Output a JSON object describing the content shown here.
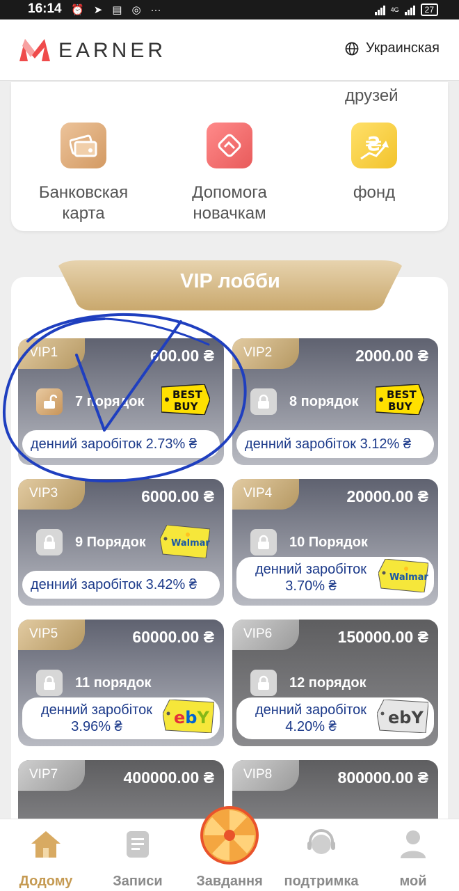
{
  "status_bar": {
    "time": "16:14",
    "icons": [
      "alarm-icon",
      "telegram-icon",
      "message-icon",
      "instagram-icon"
    ],
    "more": "···",
    "network": "4G",
    "battery": "27"
  },
  "header": {
    "brand": "EARNER",
    "language": "Украинская"
  },
  "services": {
    "partial_top": [
      "",
      "",
      "друзей"
    ],
    "items": [
      {
        "label": "Банковская\nкарта",
        "icon": "bank-card-icon",
        "color": "#dba979"
      },
      {
        "label": "Допомога\nновачкам",
        "icon": "handshake-icon",
        "color": "#ef6f6f"
      },
      {
        "label": "фонд",
        "icon": "hryvnia-growth-icon",
        "color": "#f5c938"
      }
    ]
  },
  "lobby": {
    "title": "VIP лобби",
    "cards": [
      {
        "tag": "VIP1",
        "price": "600.00 ₴",
        "order": "7 порядок",
        "earn": "денний заробіток 2.73% ₴",
        "brand": "BEST BUY",
        "lock": "open"
      },
      {
        "tag": "VIP2",
        "price": "2000.00 ₴",
        "order": "8 порядок",
        "earn": "денний заробіток 3.12% ₴",
        "brand": "BEST BUY",
        "lock": "closed"
      },
      {
        "tag": "VIP3",
        "price": "6000.00 ₴",
        "order": "9 Порядок",
        "earn": "денний заробіток 3.42% ₴",
        "brand": "Walmart",
        "lock": "closed"
      },
      {
        "tag": "VIP4",
        "price": "20000.00 ₴",
        "order": "10 Порядок",
        "earn": "денний заробіток 3.70% ₴",
        "brand": "Walmart",
        "lock": "closed"
      },
      {
        "tag": "VIP5",
        "price": "60000.00 ₴",
        "order": "11 порядок",
        "earn": "денний заробіток 3.96% ₴",
        "brand": "ebY",
        "lock": "closed"
      },
      {
        "tag": "VIP6",
        "price": "150000.00 ₴",
        "order": "12 порядок",
        "earn": "денний заробіток 4.20% ₴",
        "brand": "ebY",
        "lock": "closed"
      },
      {
        "tag": "VIP7",
        "price": "400000.00 ₴"
      },
      {
        "tag": "VIP8",
        "price": "800000.00 ₴"
      }
    ]
  },
  "bottom_nav": [
    {
      "label": "Додому",
      "icon": "home-icon",
      "active": true
    },
    {
      "label": "Записи",
      "icon": "records-icon",
      "active": false
    },
    {
      "label": "Завдання",
      "icon": "wheel-icon",
      "active": false
    },
    {
      "label": "подтримка",
      "icon": "support-icon",
      "active": false
    },
    {
      "label": "мой",
      "icon": "profile-icon",
      "active": false
    }
  ],
  "colors": {
    "accent_gold": "#c59a52",
    "earn_text": "#1c3a8a",
    "annotation": "#1f3fbf"
  }
}
